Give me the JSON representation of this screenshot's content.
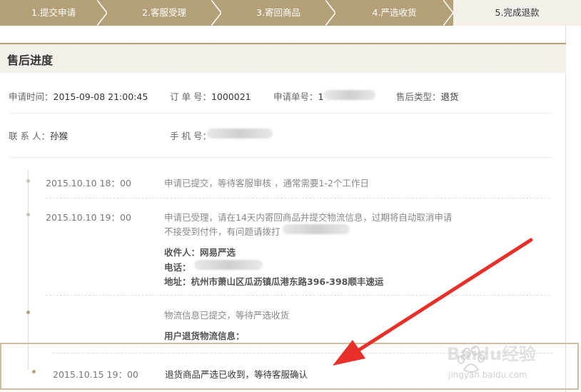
{
  "steps": [
    {
      "label": "1.提交申请",
      "active": false
    },
    {
      "label": "2.客服受理",
      "active": false
    },
    {
      "label": "3.寄回商品",
      "active": false
    },
    {
      "label": "4.严选收货",
      "active": false
    },
    {
      "label": "5.完成退款",
      "active": true
    }
  ],
  "section_title": "售后进度",
  "info": {
    "apply_time_label": "申请时间：",
    "apply_time_value": "2015-09-08  21:00:45",
    "order_no_label": "订 单 号：",
    "order_no_value": "1000021",
    "apply_no_label": "申请单号：",
    "apply_no_value": "1",
    "type_label": "售后类型：",
    "type_value": "退货",
    "contact_label": "联 系 人：",
    "contact_value": "孙猴",
    "phone_label": "手 机 号："
  },
  "timeline": [
    {
      "time": "2015.10.10   18：00",
      "lines": [
        "申请已提交，等待客服审核 ，通常需要1-2个工作日"
      ]
    },
    {
      "time": "2015.10.10   19：00",
      "lines": [
        "申请已受理，请在14天内寄回商品并提交物流信息，过期将自动取消申请",
        "不接受到付件，有问题请拨打"
      ],
      "receiver": "收件人：网易严选",
      "tel": "电话：",
      "address": "地址：杭州市萧山区瓜沥镇瓜港东路396-398顺丰速运"
    },
    {
      "time": "",
      "lines": [
        "物流信息已提交，等待严选收货"
      ],
      "sub": "用户退货物流信息："
    },
    {
      "time": "2015.10.15   19：00",
      "lines": [
        "退货商品严选已收到，等待客服确认"
      ]
    }
  ],
  "watermark": {
    "brand": "Baidu经验",
    "url": "jingyan.baidu.com"
  },
  "colors": {
    "accent": "#b4a078",
    "arrow": "#e8302a"
  }
}
